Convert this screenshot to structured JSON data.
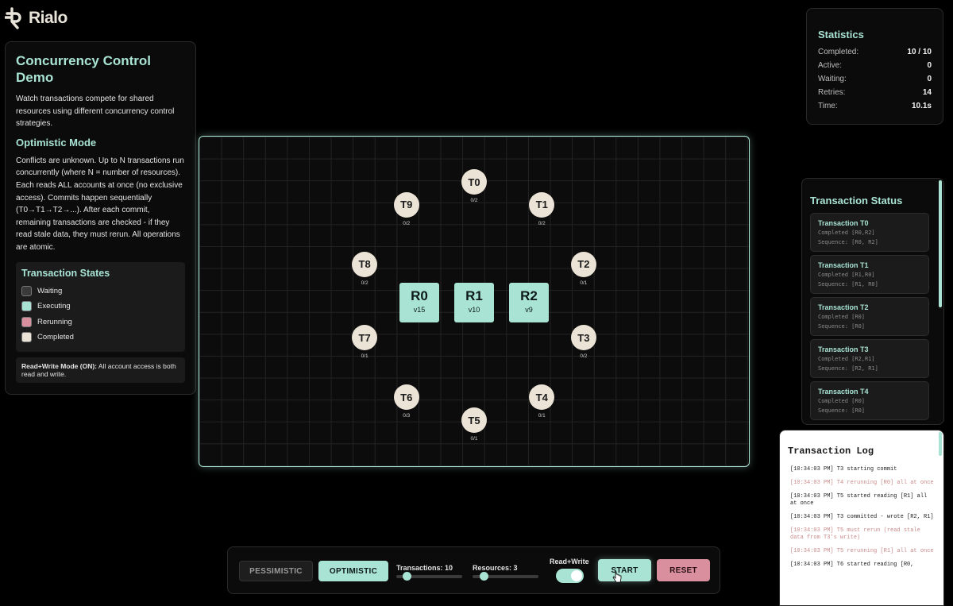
{
  "app": {
    "logo_text": "Rialo"
  },
  "info": {
    "title": "Concurrency Control Demo",
    "description": "Watch transactions compete for shared resources using different concurrency control strategies.",
    "mode_title": "Optimistic Mode",
    "mode_description": "Conflicts are unknown. Up to N transactions run concurrently (where N = number of resources). Each reads ALL accounts at once (no exclusive access). Commits happen sequentially (T0→T1→T2→...). After each commit, remaining transactions are checked - if they read stale data, they must rerun. All operations are atomic.",
    "states_title": "Transaction States",
    "states": [
      {
        "label": "Waiting",
        "color": "#3a3a3a"
      },
      {
        "label": "Executing",
        "color": "#a8e3d3"
      },
      {
        "label": "Rerunning",
        "color": "#d98f9e"
      },
      {
        "label": "Completed",
        "color": "#ebe3d6"
      }
    ],
    "rw_note_bold": "Read+Write Mode (ON):",
    "rw_note_text": " All account access is both read and write."
  },
  "canvas": {
    "resources": [
      {
        "name": "R0",
        "version": "v15"
      },
      {
        "name": "R1",
        "version": "v10"
      },
      {
        "name": "R2",
        "version": "v9"
      }
    ],
    "transactions": [
      {
        "label": "T0",
        "progress": "0/2"
      },
      {
        "label": "T1",
        "progress": "0/2"
      },
      {
        "label": "T2",
        "progress": "0/1"
      },
      {
        "label": "T3",
        "progress": "0/2"
      },
      {
        "label": "T4",
        "progress": "0/1"
      },
      {
        "label": "T5",
        "progress": "0/1"
      },
      {
        "label": "T6",
        "progress": "0/3"
      },
      {
        "label": "T7",
        "progress": "0/1"
      },
      {
        "label": "T8",
        "progress": "0/2"
      },
      {
        "label": "T9",
        "progress": "0/2"
      }
    ]
  },
  "stats": {
    "title": "Statistics",
    "rows": [
      {
        "label": "Completed:",
        "value": "10 / 10"
      },
      {
        "label": "Active:",
        "value": "0"
      },
      {
        "label": "Waiting:",
        "value": "0"
      },
      {
        "label": "Retries:",
        "value": "14"
      },
      {
        "label": "Time:",
        "value": "10.1s"
      }
    ]
  },
  "status": {
    "title": "Transaction Status",
    "cards": [
      {
        "title": "Transaction T0",
        "state": "Completed [R0,R2]",
        "sequence": "Sequence: [R0, R2]"
      },
      {
        "title": "Transaction T1",
        "state": "Completed [R1,R0]",
        "sequence": "Sequence: [R1, R0]"
      },
      {
        "title": "Transaction T2",
        "state": "Completed [R0]",
        "sequence": "Sequence: [R0]"
      },
      {
        "title": "Transaction T3",
        "state": "Completed [R2,R1]",
        "sequence": "Sequence: [R2, R1]"
      },
      {
        "title": "Transaction T4",
        "state": "Completed [R0]",
        "sequence": "Sequence: [R0]"
      }
    ]
  },
  "log": {
    "title": "Transaction Log",
    "entries": [
      {
        "text": "[10:34:03 PM] T3 starting commit",
        "kind": "normal"
      },
      {
        "text": "[10:34:03 PM] T4 rerunning [R0] all at once",
        "kind": "rerun"
      },
      {
        "text": "[10:34:03 PM] T5 started reading [R1] all at once",
        "kind": "normal"
      },
      {
        "text": "[10:34:03 PM] T3 committed - wrote [R2, R1]",
        "kind": "normal"
      },
      {
        "text": "[10:34:03 PM] T5 must rerun (read stale data from T3's write)",
        "kind": "rerun"
      },
      {
        "text": "[10:34:03 PM] T5 rerunning [R1] all at once",
        "kind": "rerun"
      },
      {
        "text": "[10:34:03 PM] T6 started reading [R0,",
        "kind": "normal"
      }
    ]
  },
  "controls": {
    "pessimistic_label": "PESSIMISTIC",
    "optimistic_label": "OPTIMISTIC",
    "transactions_label": "Transactions: 10",
    "transactions_value": 10,
    "resources_label": "Resources: 3",
    "resources_value": 3,
    "rw_label": "Read+Write",
    "rw_on": true,
    "start_label": "START",
    "reset_label": "RESET"
  }
}
